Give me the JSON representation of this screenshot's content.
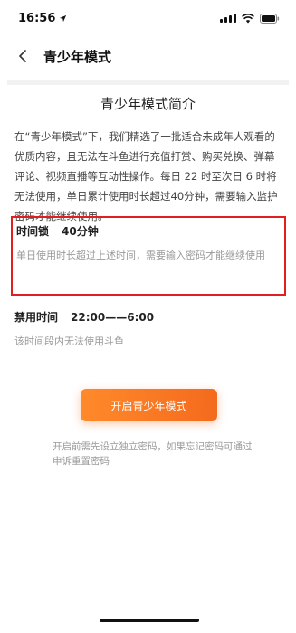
{
  "status_bar": {
    "time": "16:56"
  },
  "nav": {
    "title": "青少年模式"
  },
  "intro": {
    "title": "青少年模式简介",
    "body": "在“青少年模式”下，我们精选了一批适合未成年人观看的优质内容，且无法在斗鱼进行充值打赏、购买兑换、弹幕评论、视频直播等互动性操作。每日 22 时至次日 6 时将无法使用，单日累计使用时长超过40分钟，需要输入监护密码才能继续使用。"
  },
  "time_lock": {
    "label": "时间锁",
    "value": "40分钟",
    "description": "单日使用时长超过上述时间，需要输入密码才能继续使用"
  },
  "ban_time": {
    "label": "禁用时间",
    "value": "22:00——6:00",
    "description": "该时间段内无法使用斗鱼"
  },
  "primary_button": {
    "label": "开启青少年模式"
  },
  "footnote": "开启前需先设立独立密码，如果忘记密码可通过申诉重置密码",
  "colors": {
    "accent": "#f46a1e",
    "highlight_border": "#e02020",
    "muted_text": "#9a9a9a"
  }
}
